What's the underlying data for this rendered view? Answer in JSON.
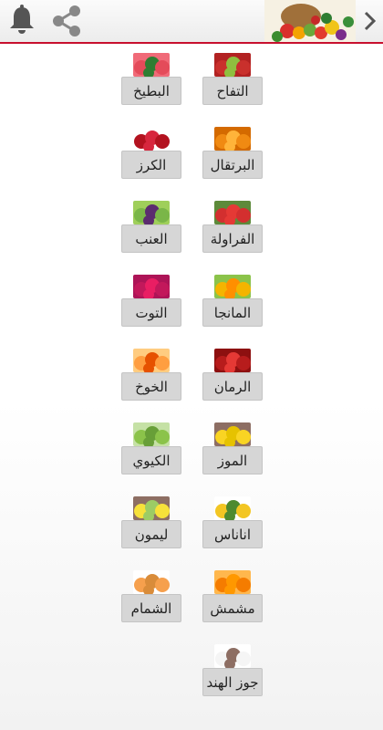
{
  "header": {
    "bell_icon": "bell-icon",
    "share_icon": "share-icon",
    "banner_image": "fruits-vegetables-basket-banner",
    "next_icon": "chevron-right-icon"
  },
  "fruits": [
    {
      "label": "التفاح",
      "thumb": "apples",
      "colors": [
        "#c9302c",
        "#8fbf3f",
        "#b22222"
      ]
    },
    {
      "label": "البطيخ",
      "thumb": "watermelon",
      "colors": [
        "#e44b5a",
        "#2f7d32",
        "#f06a78"
      ]
    },
    {
      "label": "البرتقال",
      "thumb": "oranges",
      "colors": [
        "#f08a12",
        "#ffb43a",
        "#d46a00"
      ]
    },
    {
      "label": "الكرز",
      "thumb": "cherries",
      "colors": [
        "#b3121f",
        "#d7263d",
        "#ffffff"
      ]
    },
    {
      "label": "الفراولة",
      "thumb": "strawberries",
      "colors": [
        "#d32f2f",
        "#e53935",
        "#5d8a3a"
      ]
    },
    {
      "label": "العنب",
      "thumb": "grapes",
      "colors": [
        "#7ab648",
        "#5b2c6f",
        "#9fcf5a"
      ]
    },
    {
      "label": "المانجا",
      "thumb": "mangoes",
      "colors": [
        "#f4b400",
        "#ff8f00",
        "#8bc34a"
      ]
    },
    {
      "label": "التوت",
      "thumb": "raspberries",
      "colors": [
        "#c2185b",
        "#e91e63",
        "#ad1457"
      ]
    },
    {
      "label": "الرمان",
      "thumb": "pomegranates",
      "colors": [
        "#b71c1c",
        "#e53935",
        "#8d1010"
      ]
    },
    {
      "label": "الخوخ",
      "thumb": "peaches",
      "colors": [
        "#ff9e40",
        "#e65100",
        "#ffcc80"
      ]
    },
    {
      "label": "الموز",
      "thumb": "bananas",
      "colors": [
        "#f9d423",
        "#e6c200",
        "#8d6e63"
      ]
    },
    {
      "label": "الكيوي",
      "thumb": "kiwis",
      "colors": [
        "#8bc34a",
        "#689f38",
        "#c5e1a5"
      ]
    },
    {
      "label": "اناناس",
      "thumb": "pineapple",
      "colors": [
        "#f3c623",
        "#4e8a2f",
        "#ffffff"
      ]
    },
    {
      "label": "ليمون",
      "thumb": "lemons",
      "colors": [
        "#f7e13a",
        "#9ccc65",
        "#8d6e63"
      ]
    },
    {
      "label": "مشمش",
      "thumb": "apricots",
      "colors": [
        "#f57c00",
        "#ff9800",
        "#ffb74d"
      ]
    },
    {
      "label": "الشمام",
      "thumb": "cantaloupe",
      "colors": [
        "#f6a04d",
        "#d98c3a",
        "#ffffff"
      ]
    },
    {
      "label": "جوز الهند",
      "thumb": "coconut",
      "colors": [
        "#f5f5f5",
        "#8d6e63",
        "#ffffff"
      ]
    }
  ]
}
